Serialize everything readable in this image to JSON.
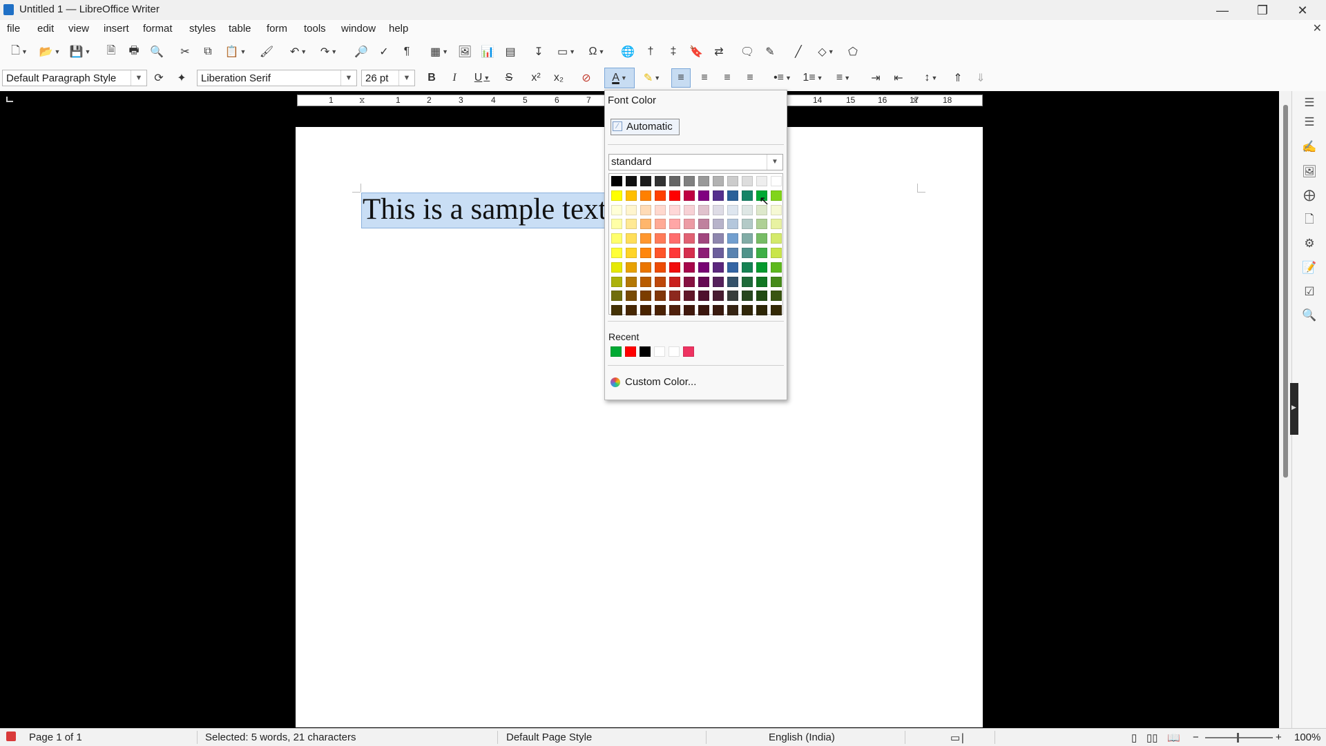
{
  "window": {
    "title": "Untitled 1 — LibreOffice Writer",
    "minimize_icon": "minimize-icon",
    "maximize_icon": "maximize-icon",
    "close_icon": "close-icon"
  },
  "menubar": {
    "items": [
      "file",
      "edit",
      "view",
      "insert",
      "format",
      "styles",
      "table",
      "form",
      "tools",
      "window",
      "help"
    ]
  },
  "formatting": {
    "paragraph_style": "Default Paragraph Style",
    "font_name": "Liberation Serif",
    "font_size": "26 pt"
  },
  "ruler": {
    "labels": [
      "1",
      "1",
      "2",
      "3",
      "4",
      "5",
      "6",
      "7",
      "14",
      "15",
      "16",
      "17",
      "18"
    ]
  },
  "document": {
    "selected_text": "This is a sample text"
  },
  "font_color_popup": {
    "title": "Font Color",
    "automatic_label": "Automatic",
    "palette_name": "standard",
    "recent_label": "Recent",
    "custom_label": "Custom Color...",
    "palette_rows": [
      [
        "#000000",
        "#111111",
        "#1c1c1c",
        "#333333",
        "#666666",
        "#808080",
        "#999999",
        "#b2b2b2",
        "#cccccc",
        "#dddddd",
        "#eeeeee",
        "#ffffff"
      ],
      [
        "#ffff00",
        "#ffbf00",
        "#ff8000",
        "#ff4000",
        "#ff0000",
        "#bf0041",
        "#800080",
        "#55308d",
        "#2a6099",
        "#158466",
        "#00a933",
        "#81d41a"
      ],
      [
        "#ffffd7",
        "#fff5ce",
        "#ffdbb6",
        "#ffd8ce",
        "#ffd7d7",
        "#f7d1d5",
        "#e0c2cd",
        "#dedce6",
        "#dee6ef",
        "#dee7e5",
        "#dde8cb",
        "#f6f9d4"
      ],
      [
        "#ffffa6",
        "#ffe994",
        "#ffb66c",
        "#ffaa95",
        "#ffa6a6",
        "#ec9ba4",
        "#bf819e",
        "#b7b3ca",
        "#b4c7dc",
        "#b3cac7",
        "#afd095",
        "#e8f2a1"
      ],
      [
        "#ffff6d",
        "#ffde59",
        "#ff972f",
        "#ff7b59",
        "#ff6d6d",
        "#e16173",
        "#a1467e",
        "#8e86ae",
        "#729fcf",
        "#81aca6",
        "#77bc65",
        "#d4ea6b"
      ],
      [
        "#ffff38",
        "#ffd428",
        "#ff860d",
        "#ff5429",
        "#ff3838",
        "#d62e4e",
        "#8d1d75",
        "#6b5e9b",
        "#5983b0",
        "#50938a",
        "#3faf46",
        "#c9e54a"
      ],
      [
        "#e6e905",
        "#e8a202",
        "#ea7500",
        "#ed4c05",
        "#f10d0c",
        "#a7074b",
        "#780373",
        "#5b277d",
        "#3465a4",
        "#168253",
        "#069a2e",
        "#5eb91e"
      ],
      [
        "#acb20c",
        "#b47804",
        "#b85c00",
        "#be480a",
        "#c9211e",
        "#861141",
        "#650953",
        "#55215b",
        "#355269",
        "#1e6a39",
        "#127622",
        "#468a1a"
      ],
      [
        "#706e0c",
        "#784b04",
        "#7b3d00",
        "#813709",
        "#8d281e",
        "#611729",
        "#4e102d",
        "#481d32",
        "#383d3c",
        "#28471f",
        "#224b12",
        "#395511"
      ],
      [
        "#443205",
        "#472702",
        "#492300",
        "#4b2204",
        "#50200c",
        "#41190d",
        "#3b160e",
        "#3a1a0f",
        "#362413",
        "#302709",
        "#2e2706",
        "#342a06"
      ]
    ],
    "recent_colors": [
      "#00a933",
      "#ff0000",
      "#000000",
      "#ffffff",
      "#ffffff",
      "#ee3361"
    ]
  },
  "status": {
    "page": "Page 1 of 1",
    "selection": "Selected: 5 words, 21 characters",
    "page_style": "Default Page Style",
    "language": "English (India)",
    "zoom": "100%"
  }
}
